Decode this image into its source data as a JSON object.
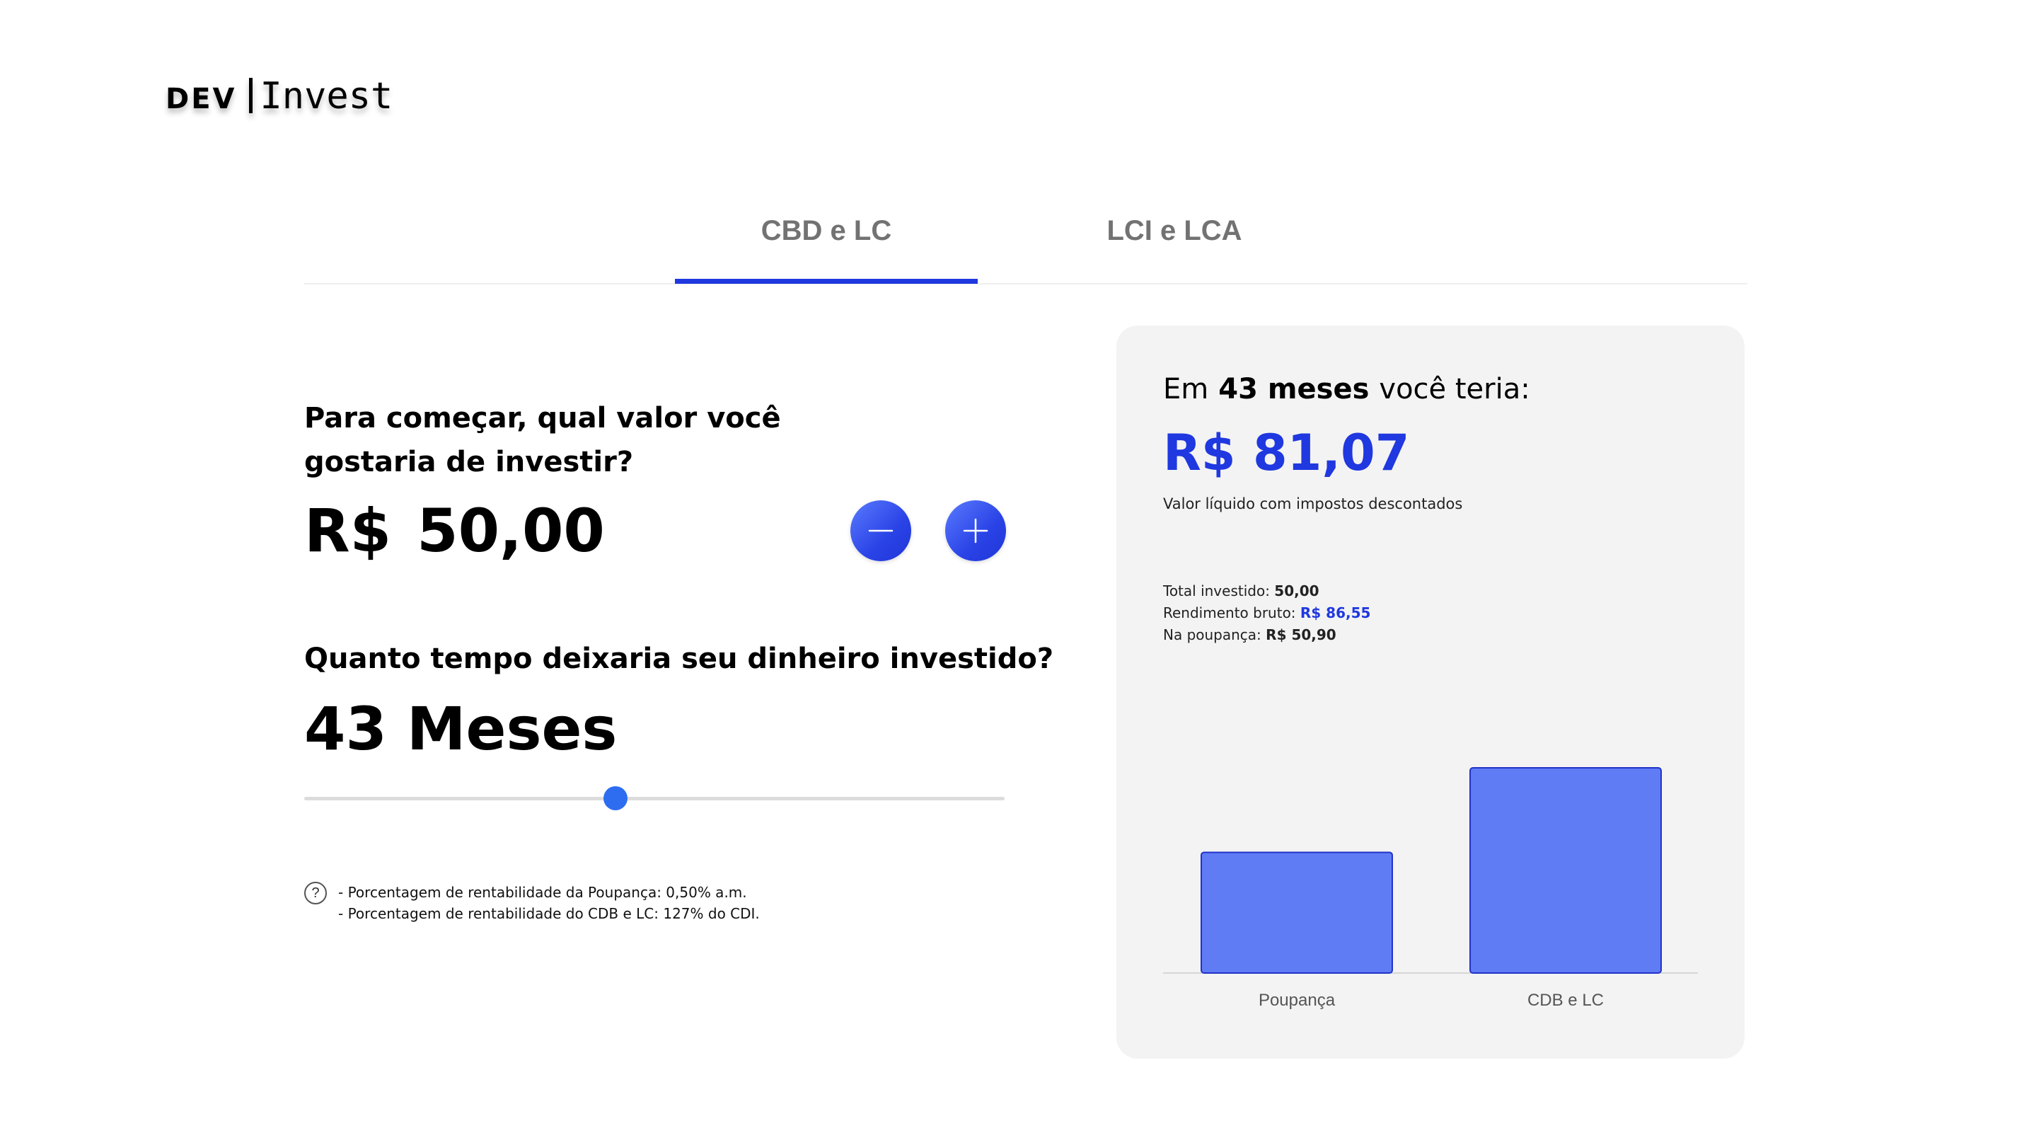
{
  "logo": {
    "part1": "DEV",
    "part2": "Invest"
  },
  "tabs": [
    {
      "label": "CBD e LC",
      "active": true
    },
    {
      "label": "LCI e LCA",
      "active": false
    }
  ],
  "investment": {
    "question": "Para começar, qual valor você gostaria de investir?",
    "currency": "R$",
    "amount": "50,00",
    "minus_icon": "minus-icon",
    "plus_icon": "plus-icon"
  },
  "period": {
    "question": "Quanto tempo deixaria seu dinheiro investido?",
    "months": "43",
    "unit": "Meses",
    "slider_fraction": 0.444
  },
  "info": {
    "icon": "question-icon",
    "lines": [
      "- Porcentagem de rentabilidade da Poupança: 0,50% a.m.",
      "- Porcentagem de rentabilidade do CDB e LC: 127% do CDI."
    ]
  },
  "result": {
    "prefix": "Em",
    "period": "43 meses",
    "suffix": "você teria:",
    "net_value": "R$ 81,07",
    "net_caption": "Valor líquido com impostos descontados",
    "total_label": "Total investido:",
    "total_value": "50,00",
    "gross_label": "Rendimento bruto:",
    "gross_value": "R$ 86,55",
    "savings_label": "Na poupança:",
    "savings_value": "R$ 50,90"
  },
  "colors": {
    "accent": "#1f38e0",
    "bar_fill": "#5f7cf5",
    "bar_stroke": "#2233c8",
    "card_bg": "#f3f3f3"
  },
  "chart_data": {
    "type": "bar",
    "categories": [
      "Poupança",
      "CDB e LC"
    ],
    "values": [
      50.9,
      86.55
    ],
    "title": "",
    "xlabel": "",
    "ylabel": "",
    "ylim": [
      0,
      86.55
    ]
  }
}
